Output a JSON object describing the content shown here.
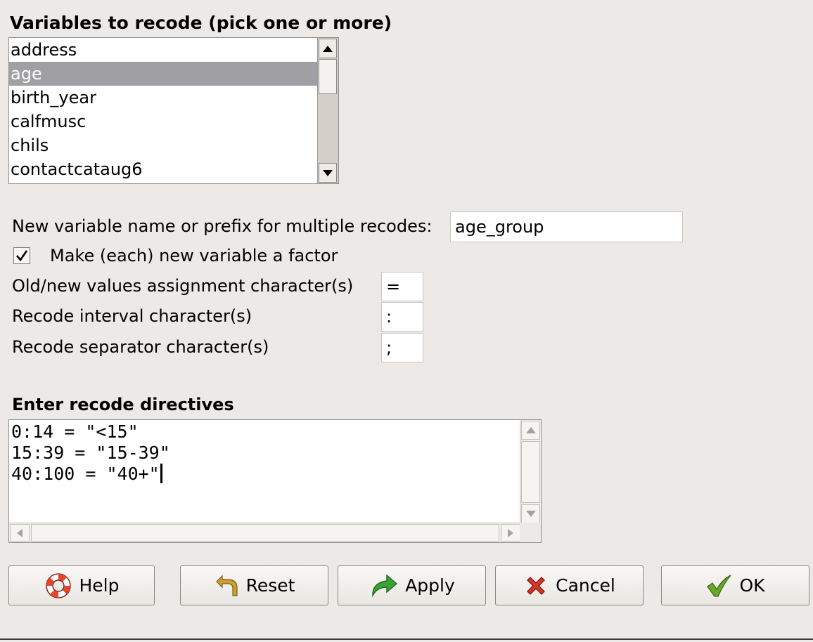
{
  "variables_section": {
    "heading": "Variables to recode (pick one or more)",
    "items": [
      "address",
      "age",
      "birth_year",
      "calfmusc",
      "chils",
      "contactcataug6"
    ],
    "selected": "age"
  },
  "new_name": {
    "label": "New variable name or prefix for multiple recodes:",
    "value": "age_group"
  },
  "factor": {
    "label": "Make (each) new variable a factor",
    "checked": true
  },
  "assignment": {
    "label": "Old/new values assignment character(s)",
    "value": "="
  },
  "interval": {
    "label": "Recode interval character(s)",
    "value": ":"
  },
  "separator": {
    "label": "Recode separator character(s)",
    "value": ";"
  },
  "directives": {
    "heading": "Enter recode directives",
    "lines": [
      "0:14 = \"<15\"",
      "15:39 = \"15-39\"",
      "40:100 = \"40+\""
    ]
  },
  "buttons": {
    "help": "Help",
    "reset": "Reset",
    "apply": "Apply",
    "cancel": "Cancel",
    "ok": "OK"
  },
  "colors": {
    "background": "#ece9e6",
    "selection": "#a09fa4",
    "help_icon": "#e8442c",
    "reset_icon": "#c9a032",
    "apply_icon": "#3aa336",
    "cancel_icon": "#d8342c",
    "ok_icon": "#6aa82a"
  }
}
